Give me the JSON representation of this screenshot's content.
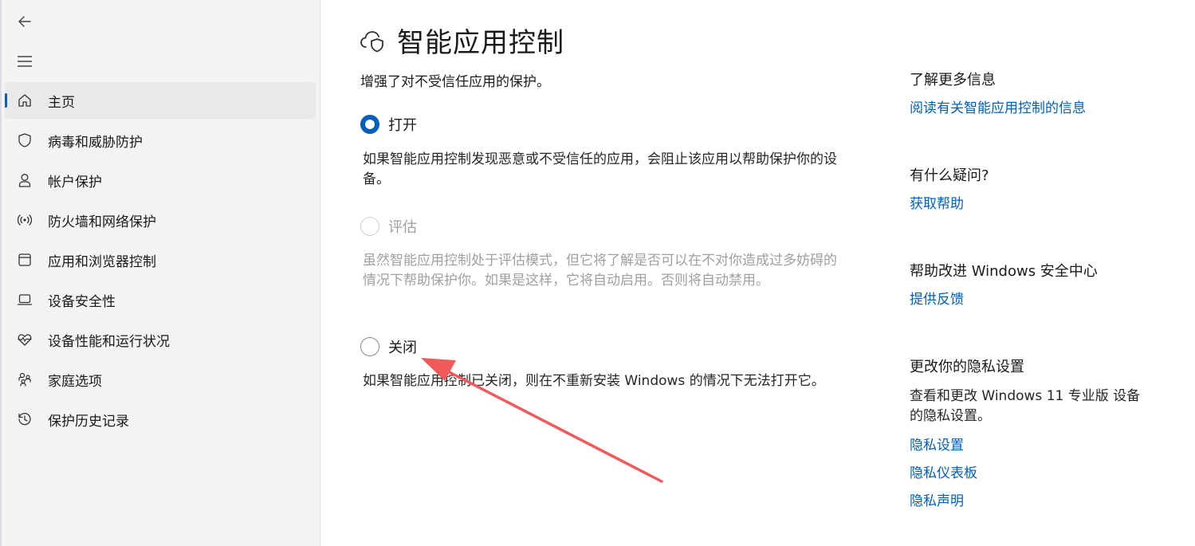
{
  "sidebar": {
    "items": [
      {
        "label": "主页",
        "icon": "home-icon",
        "active": true
      },
      {
        "label": "病毒和威胁防护",
        "icon": "shield-icon"
      },
      {
        "label": "帐户保护",
        "icon": "person-icon"
      },
      {
        "label": "防火墙和网络保护",
        "icon": "wifi-antenna-icon"
      },
      {
        "label": "应用和浏览器控制",
        "icon": "app-window-icon"
      },
      {
        "label": "设备安全性",
        "icon": "laptop-icon"
      },
      {
        "label": "设备性能和运行状况",
        "icon": "heart-pulse-icon"
      },
      {
        "label": "家庭选项",
        "icon": "family-icon"
      },
      {
        "label": "保护历史记录",
        "icon": "history-icon"
      }
    ]
  },
  "main": {
    "title": "智能应用控制",
    "subtitle": "增强了对不受信任应用的保护。",
    "options": [
      {
        "label": "打开",
        "state": "checked",
        "description": "如果智能应用控制发现恶意或不受信任的应用，会阻止该应用以帮助保护你的设备。"
      },
      {
        "label": "评估",
        "state": "disabled",
        "description": "虽然智能应用控制处于评估模式，但它将了解是否可以在不对你造成过多妨碍的情况下帮助保护你。如果是这样，它将自动启用。否则将自动禁用。"
      },
      {
        "label": "关闭",
        "state": "unchecked",
        "description": "如果智能应用控制已关闭，则在不重新安装 Windows 的情况下无法打开它。"
      }
    ]
  },
  "side": {
    "learn_more": {
      "heading": "了解更多信息",
      "link": "阅读有关智能应用控制的信息"
    },
    "questions": {
      "heading": "有什么疑问?",
      "link": "获取帮助"
    },
    "improve": {
      "heading": "帮助改进 Windows 安全中心",
      "link": "提供反馈"
    },
    "privacy": {
      "heading": "更改你的隐私设置",
      "text": "查看和更改 Windows 11 专业版 设备的隐私设置。",
      "links": [
        "隐私设置",
        "隐私仪表板",
        "隐私声明"
      ]
    }
  },
  "colors": {
    "accent": "#005fb8",
    "annotation_arrow": "#f05a5a"
  }
}
